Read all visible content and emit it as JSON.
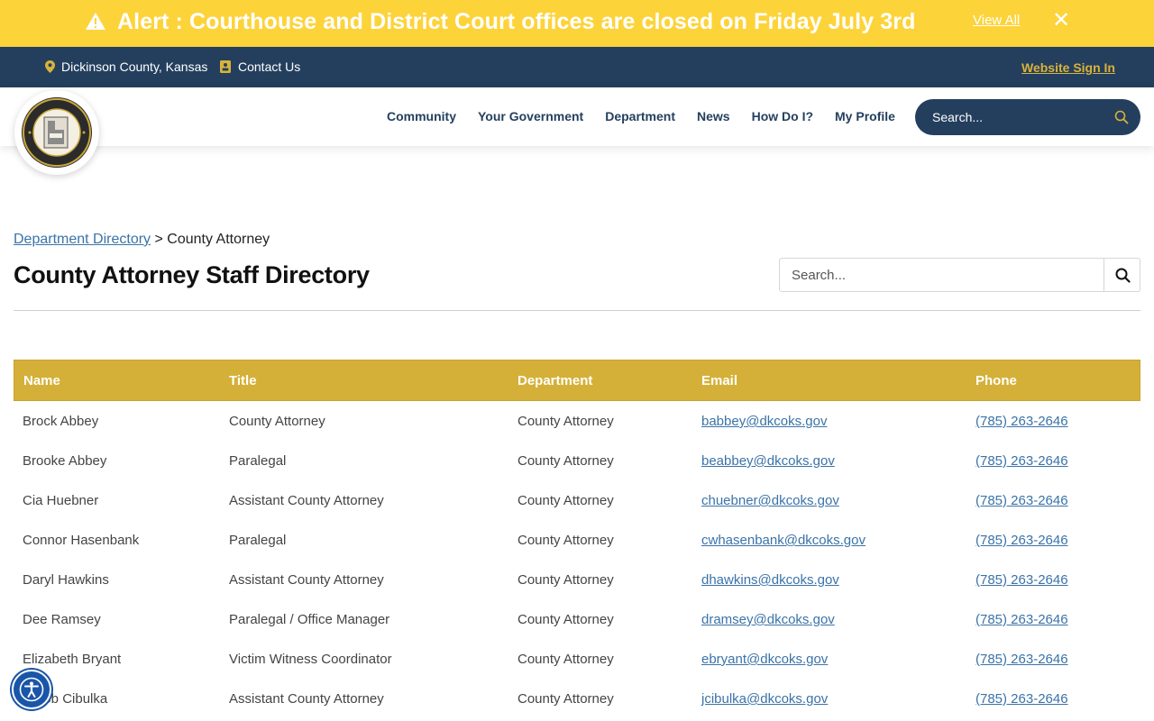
{
  "alert": {
    "text": "Alert : Courthouse and District Court offices are closed on Friday July 3rd",
    "view_all": "View All",
    "close": "✕"
  },
  "top_bar": {
    "location": "Dickinson County, Kansas",
    "contact": "Contact Us",
    "sign_in": "Website Sign In"
  },
  "nav": {
    "links": [
      "Community",
      "Your Government",
      "Department",
      "News",
      "How Do I?",
      "My Profile"
    ],
    "search_placeholder": "Search..."
  },
  "breadcrumb": {
    "parent": "Department Directory",
    "separator": ">",
    "current": "County Attorney"
  },
  "page_title": "County Attorney Staff Directory",
  "directory_search": {
    "placeholder": "Search..."
  },
  "table": {
    "headers": [
      "Name",
      "Title",
      "Department",
      "Email",
      "Phone"
    ],
    "rows": [
      [
        "Brock Abbey",
        "County Attorney",
        "County Attorney",
        "babbey@dkcoks.gov",
        "(785) 263-2646"
      ],
      [
        "Brooke Abbey",
        "Paralegal",
        "County Attorney",
        "beabbey@dkcoks.gov",
        "(785) 263-2646"
      ],
      [
        "Cia Huebner",
        "Assistant County Attorney",
        "County Attorney",
        "chuebner@dkcoks.gov",
        "(785) 263-2646"
      ],
      [
        "Connor Hasenbank",
        "Paralegal",
        "County Attorney",
        "cwhasenbank@dkcoks.gov",
        "(785) 263-2646"
      ],
      [
        "Daryl Hawkins",
        "Assistant County Attorney",
        "County Attorney",
        "dhawkins@dkcoks.gov",
        "(785) 263-2646"
      ],
      [
        "Dee Ramsey",
        "Paralegal / Office Manager",
        "County Attorney",
        "dramsey@dkcoks.gov",
        "(785) 263-2646"
      ],
      [
        "Elizabeth Bryant",
        "Victim Witness Coordinator",
        "County Attorney",
        "ebryant@dkcoks.gov",
        "(785) 263-2646"
      ],
      [
        "Jacob Cibulka",
        "Assistant County Attorney",
        "County Attorney",
        "jcibulka@dkcoks.gov",
        "(785) 263-2646"
      ]
    ]
  },
  "colors": {
    "alert_bg": "#fdd33a",
    "navy": "#243f5e",
    "gold": "#d4b038",
    "link": "#3a73a8"
  },
  "icons": [
    "warning-icon",
    "map-pin-icon",
    "contact-card-icon",
    "search-icon",
    "county-seal-logo",
    "accessibility-icon"
  ]
}
